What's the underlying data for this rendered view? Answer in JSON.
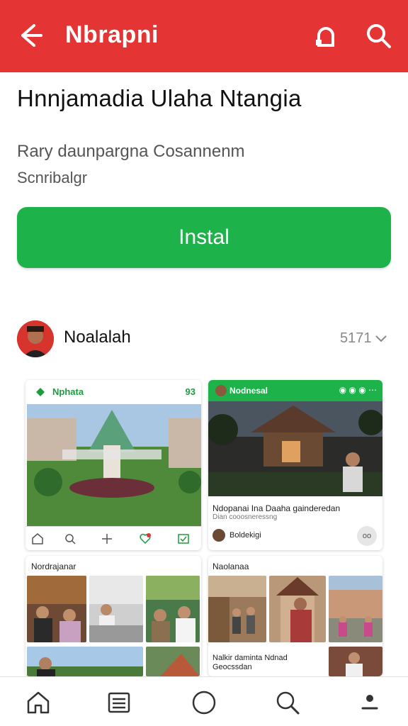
{
  "topbar": {
    "title": "Nbrapni",
    "back_icon": "arrow-left-icon",
    "share_icon": "share-icon",
    "search_icon": "search-icon",
    "color": "#e53434"
  },
  "app": {
    "title": "Hnnjamadia Ulaha Ntangia",
    "subtitle_line1": "Rary daunpargna Cosannenm",
    "subtitle_line2": "Scnribalgr"
  },
  "install_button": {
    "label": "Instal",
    "color": "#1eb24a"
  },
  "developer": {
    "name": "Noalalah",
    "count": "5171",
    "expand_icon": "chevron-down-icon"
  },
  "screenshots": {
    "card1": {
      "header_label": "Nphata",
      "header_right": "93"
    },
    "card2": {
      "header_label": "Nodnesal",
      "caption": "Ndopanai Ina Daaha gainderedan",
      "caption2": "Dian cooosneressng",
      "username": "Boldekigi",
      "more_label": "oo"
    },
    "card3": {
      "label": "Nordrajanar"
    },
    "card4": {
      "label": "Naolanaa",
      "caption": "Nalkir daminta Ndnad",
      "caption2": "Geocssdan"
    }
  },
  "bottom_nav": [
    {
      "name": "nav-home",
      "icon": "home-icon"
    },
    {
      "name": "nav-list",
      "icon": "list-icon"
    },
    {
      "name": "nav-circle",
      "icon": "circle-icon"
    },
    {
      "name": "nav-search",
      "icon": "search-icon"
    },
    {
      "name": "nav-profile",
      "icon": "profile-icon"
    }
  ]
}
